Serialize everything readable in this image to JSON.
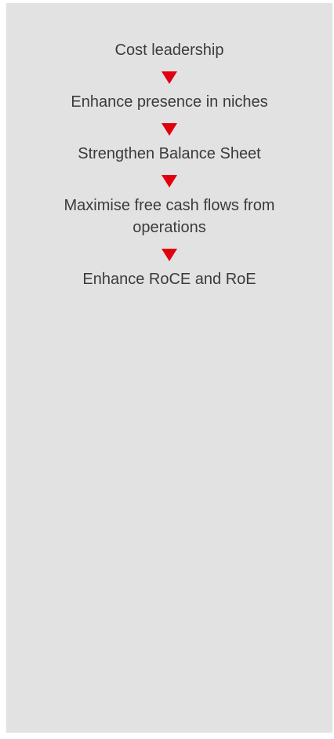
{
  "flow": {
    "steps": [
      "Cost leadership",
      "Enhance presence in niches",
      "Strengthen Balance Sheet",
      "Maximise free cash flows from operations",
      "Enhance RoCE and RoE"
    ],
    "arrow_icon": "down-triangle-icon",
    "arrow_color": "#e1000f",
    "text_color": "#3b3b3b",
    "panel_color": "#e2e2e2"
  }
}
